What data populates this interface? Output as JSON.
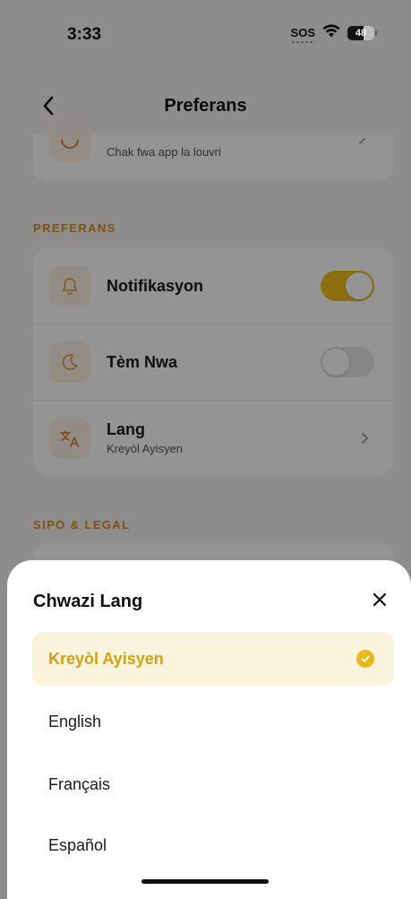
{
  "status_bar": {
    "time": "3:33",
    "sos": "SOS",
    "battery": "48"
  },
  "nav": {
    "title": "Preferans"
  },
  "partial_row": {
    "subtitle": "Chak fwa app la louvri"
  },
  "sections": {
    "preferences_label": "PREFERANS",
    "legal_label": "SIPO & LEGAL"
  },
  "preferences": {
    "notifications": {
      "title": "Notifikasyon",
      "enabled": true,
      "icon": "bell-icon"
    },
    "dark_mode": {
      "title": "Tèm Nwa",
      "enabled": false,
      "icon": "moon-icon"
    },
    "language": {
      "title": "Lang",
      "subtitle": "Kreyòl Ayisyen",
      "icon": "translate-icon"
    }
  },
  "sheet": {
    "title": "Chwazi Lang",
    "options": [
      {
        "label": "Kreyòl Ayisyen",
        "selected": true
      },
      {
        "label": "English",
        "selected": false
      },
      {
        "label": "Français",
        "selected": false
      },
      {
        "label": "Español",
        "selected": false
      }
    ]
  },
  "colors": {
    "accent": "#f2c21a",
    "accent_text": "#d4a00f",
    "section_label": "#d8901d",
    "icon_bg": "#fdf2e6",
    "selected_bg": "#fbf3dc"
  }
}
